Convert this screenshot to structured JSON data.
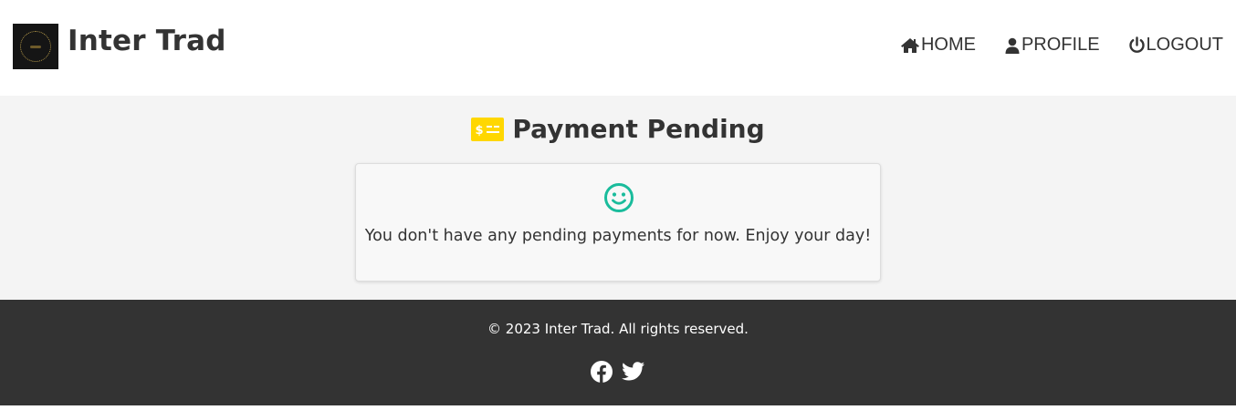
{
  "header": {
    "brand": "Inter Trad",
    "nav": [
      {
        "label": "HOME",
        "icon": "home-icon"
      },
      {
        "label": "PROFILE",
        "icon": "user-icon"
      },
      {
        "label": "LOGOUT",
        "icon": "power-icon"
      }
    ]
  },
  "main": {
    "title": "Payment Pending",
    "title_icon": "money-bill-icon",
    "message": "You don't have any pending payments for now. Enjoy your day!",
    "message_icon": "smile-icon"
  },
  "footer": {
    "copyright": "© 2023 Inter Trad. All rights reserved.",
    "social": [
      {
        "icon": "facebook-icon"
      },
      {
        "icon": "twitter-icon"
      }
    ]
  },
  "colors": {
    "accent_yellow": "#ffd700",
    "smile_teal": "#1abc9c",
    "footer_bg": "#333333",
    "main_bg": "#f4f4f4"
  }
}
